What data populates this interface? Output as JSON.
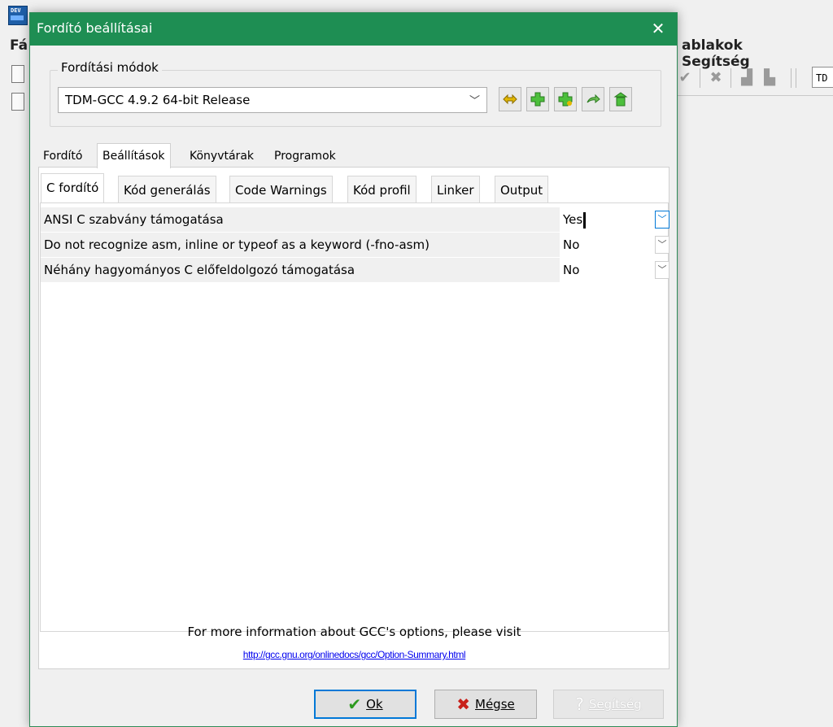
{
  "background": {
    "app_icon_text": "DEV",
    "menu_left": "Fá",
    "menu_items": [
      "ablakok",
      "Segítség"
    ],
    "toolbar_combo": "TD"
  },
  "dialog": {
    "title": "Fordító beállításai",
    "close_icon": "✕",
    "modes_group_label": "Fordítási módok",
    "selected_mode": "TDM-GCC 4.9.2 64-bit Release",
    "mode_buttons": [
      "rename-icon",
      "add-icon",
      "add-copy-icon",
      "export-icon",
      "delete-icon"
    ],
    "tabs": [
      "Fordító",
      "Beállítások",
      "Könyvtárak",
      "Programok"
    ],
    "active_tab": "Beállítások",
    "subtabs": [
      "C fordító",
      "Kód generálás",
      "Code Warnings",
      "Kód profil",
      "Linker",
      "Output"
    ],
    "active_subtab": "C fordító",
    "options": [
      {
        "label": "ANSI C szabvány támogatása",
        "value": "Yes"
      },
      {
        "label": "Do not recognize asm, inline or typeof as a keyword (-fno-asm)",
        "value": "No"
      },
      {
        "label": "Néhány hagyományos C előfeldolgozó támogatása",
        "value": "No"
      }
    ],
    "info_text": "For more information about GCC's options, please visit",
    "info_link": "http://gcc.gnu.org/onlinedocs/gcc/Option-Summary.html",
    "buttons": {
      "ok": "Ok",
      "cancel": "Mégse",
      "help": "Segítség"
    },
    "colors": {
      "titlebar": "#1e8e53",
      "focus": "#0078d7",
      "link": "#0000ee"
    }
  }
}
